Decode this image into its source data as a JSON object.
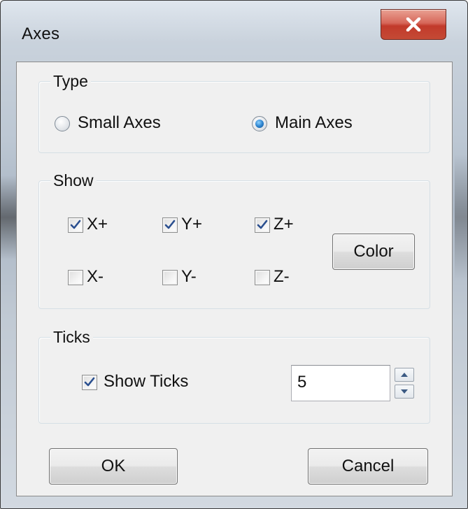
{
  "window": {
    "title": "Axes"
  },
  "type_group": {
    "label": "Type",
    "small_axes": {
      "label": "Small Axes",
      "checked": false
    },
    "main_axes": {
      "label": "Main Axes",
      "checked": true
    }
  },
  "show_group": {
    "label": "Show",
    "x_plus": {
      "label": "X+",
      "checked": true
    },
    "y_plus": {
      "label": "Y+",
      "checked": true
    },
    "z_plus": {
      "label": "Z+",
      "checked": true
    },
    "x_minus": {
      "label": "X-",
      "checked": false
    },
    "y_minus": {
      "label": "Y-",
      "checked": false
    },
    "z_minus": {
      "label": "Z-",
      "checked": false
    },
    "color_button": "Color"
  },
  "ticks_group": {
    "label": "Ticks",
    "show_ticks": {
      "label": "Show Ticks",
      "checked": true
    },
    "count_value": "5"
  },
  "buttons": {
    "ok": "OK",
    "cancel": "Cancel"
  },
  "colors": {
    "close_button": "#c23a2b",
    "dialog_bg": "#f0f0f0",
    "radio_selected": "#2f86d1"
  }
}
